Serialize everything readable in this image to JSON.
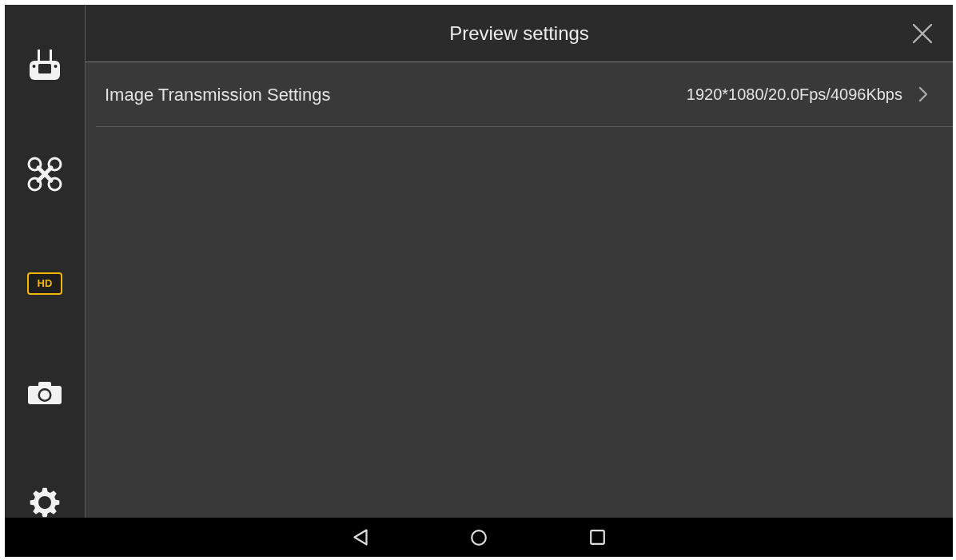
{
  "sidebar": {
    "items": [
      {
        "kind": "remote",
        "selected": false
      },
      {
        "kind": "drone",
        "selected": false
      },
      {
        "kind": "badge",
        "label": "HD",
        "selected": true
      },
      {
        "kind": "camera",
        "selected": false
      },
      {
        "kind": "gear",
        "selected": false
      }
    ]
  },
  "header": {
    "title": "Preview settings"
  },
  "settings": [
    {
      "label": "Image Transmission Settings",
      "value": "1920*1080/20.0Fps/4096Kbps"
    }
  ]
}
